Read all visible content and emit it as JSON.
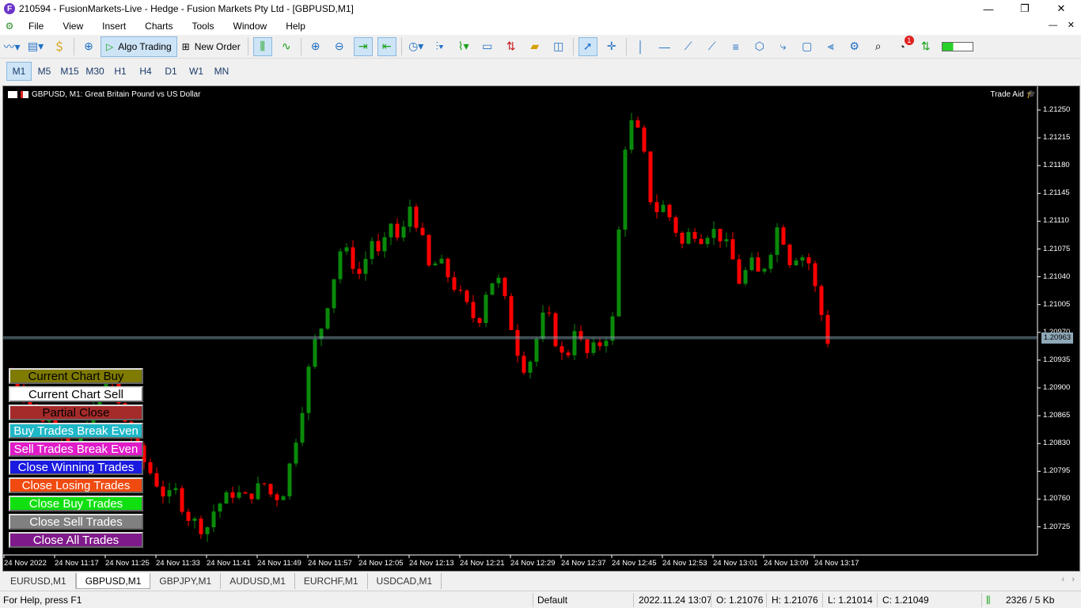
{
  "window": {
    "title": "210594 - FusionMarkets-Live - Hedge - Fusion Markets Pty Ltd - [GBPUSD,M1]",
    "app_icon_letter": "F"
  },
  "menu": [
    "File",
    "View",
    "Insert",
    "Charts",
    "Tools",
    "Window",
    "Help"
  ],
  "toolbar": {
    "algo_trading_label": "Algo Trading",
    "new_order_label": "New Order",
    "notification_count": "1"
  },
  "timeframes": [
    "M1",
    "M5",
    "M15",
    "M30",
    "H1",
    "H4",
    "D1",
    "W1",
    "MN"
  ],
  "active_timeframe": "M1",
  "chart": {
    "header": "GBPUSD, M1:  Great Britain Pound vs US Dollar",
    "trade_aid_label": "Trade Aid",
    "current_price": "1.20963"
  },
  "buttons": [
    {
      "label": "Current Chart Buy",
      "bg": "#7f7a00",
      "color": "#000000"
    },
    {
      "label": "Current Chart Sell",
      "bg": "#ffffff",
      "color": "#000000"
    },
    {
      "label": "Partial Close",
      "bg": "#a52a2a",
      "color": "#000000"
    },
    {
      "label": "Buy Trades Break Even",
      "bg": "#1fb8c8",
      "color": "#ffffff"
    },
    {
      "label": "Sell Trades Break Even",
      "bg": "#e01cc8",
      "color": "#ffffff"
    },
    {
      "label": "Close Winning Trades",
      "bg": "#1a1ae0",
      "color": "#ffffff"
    },
    {
      "label": "Close Losing Trades",
      "bg": "#f04a10",
      "color": "#ffffff"
    },
    {
      "label": "Close Buy Trades",
      "bg": "#10e010",
      "color": "#ffffff"
    },
    {
      "label": "Close Sell Trades",
      "bg": "#808080",
      "color": "#ffffff"
    },
    {
      "label": "Close All Trades",
      "bg": "#7f1a8a",
      "color": "#ffffff"
    }
  ],
  "tabs": [
    "EURUSD,M1",
    "GBPUSD,M1",
    "GBPJPY,M1",
    "AUDUSD,M1",
    "EURCHF,M1",
    "USDCAD,M1"
  ],
  "active_tab": "GBPUSD,M1",
  "status": {
    "help": "For Help, press F1",
    "profile": "Default",
    "datetime": "2022.11.24 13:07",
    "open": "O: 1.21076",
    "high": "H: 1.21076",
    "low": "L: 1.21014",
    "close": "C: 1.21049",
    "traffic": "2326 / 5 Kb"
  },
  "chart_data": {
    "type": "candlestick",
    "symbol": "GBPUSD",
    "timeframe": "M1",
    "y_ticks": [
      "1.21250",
      "1.21215",
      "1.21180",
      "1.21145",
      "1.21110",
      "1.21075",
      "1.21040",
      "1.21005",
      "1.20970",
      "1.20935",
      "1.20900",
      "1.20865",
      "1.20830",
      "1.20795",
      "1.20760",
      "1.20725"
    ],
    "x_ticks": [
      "24 Nov 2022",
      "24 Nov 11:17",
      "24 Nov 11:25",
      "24 Nov 11:33",
      "24 Nov 11:41",
      "24 Nov 11:49",
      "24 Nov 11:57",
      "24 Nov 12:05",
      "24 Nov 12:13",
      "24 Nov 12:21",
      "24 Nov 12:29",
      "24 Nov 12:37",
      "24 Nov 12:45",
      "24 Nov 12:53",
      "24 Nov 13:01",
      "24 Nov 13:09",
      "24 Nov 13:17"
    ],
    "ylim": [
      1.207,
      1.2128
    ],
    "close_path": [
      1.2092,
      1.209,
      1.2088,
      1.2086,
      1.2087,
      1.2085,
      1.2082,
      1.2083,
      1.2086,
      1.2089,
      1.2092,
      1.2088,
      1.2085,
      1.2082,
      1.208,
      1.2078,
      1.2076,
      1.2077,
      1.2074,
      1.2073,
      1.2072,
      1.2075,
      1.2076,
      1.2077,
      1.2076,
      1.2077,
      1.2078,
      1.2076,
      1.2077,
      1.2082,
      1.2088,
      1.2095,
      1.2098,
      1.2103,
      1.2108,
      1.2106,
      1.2104,
      1.2109,
      1.2106,
      1.2111,
      1.2108,
      1.2113,
      1.211,
      1.2105,
      1.2106,
      1.2104,
      1.2102,
      1.21,
      1.2098,
      1.2103,
      1.2104,
      1.21,
      1.2095,
      1.2092,
      1.2096,
      1.21,
      1.2096,
      1.2093,
      1.2098,
      1.2094,
      1.2095,
      1.2096,
      1.2099,
      1.212,
      1.2124,
      1.212,
      1.2112,
      1.2113,
      1.2111,
      1.2108,
      1.211,
      1.2109,
      1.211,
      1.2109,
      1.2107,
      1.2103,
      1.2106,
      1.2104,
      1.2107,
      1.2111,
      1.2106,
      1.2107,
      1.2106,
      1.2101,
      1.2096
    ]
  }
}
